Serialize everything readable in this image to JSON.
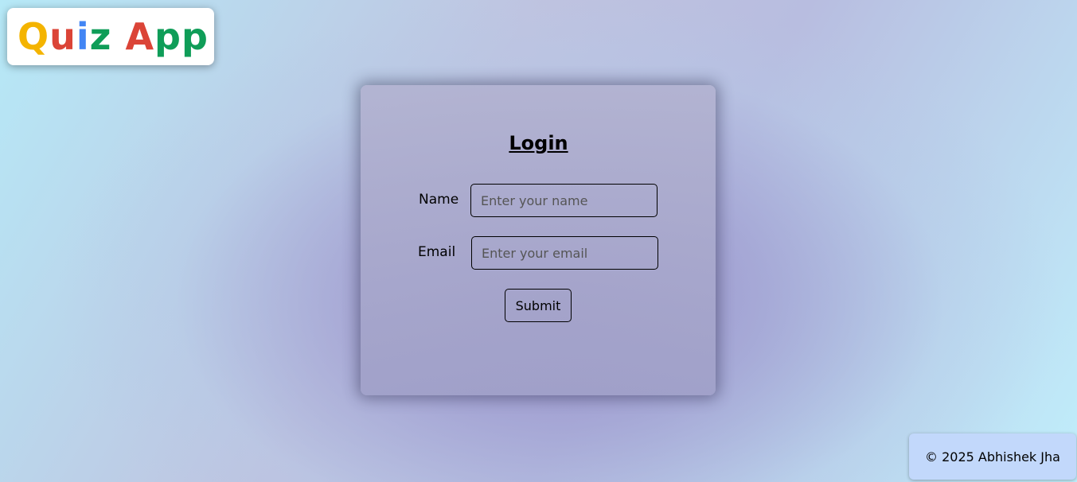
{
  "logo": {
    "letters": [
      {
        "char": "Q",
        "color": "#f4b400"
      },
      {
        "char": "u",
        "color": "#db4437"
      },
      {
        "char": "i",
        "color": "#4285f4"
      },
      {
        "char": "z",
        "color": "#0f9d58"
      },
      {
        "char": " ",
        "color": "#000000"
      },
      {
        "char": "A",
        "color": "#db4437"
      },
      {
        "char": "p",
        "color": "#0f9d58"
      },
      {
        "char": "p",
        "color": "#0f9d58"
      }
    ]
  },
  "login": {
    "title": "Login",
    "name_label": "Name",
    "name_placeholder": "Enter your name",
    "name_value": "",
    "email_label": "Email",
    "email_placeholder": "Enter your email",
    "email_value": "",
    "submit_label": "Submit"
  },
  "footer": {
    "text": "© 2025 Abhishek Jha"
  }
}
